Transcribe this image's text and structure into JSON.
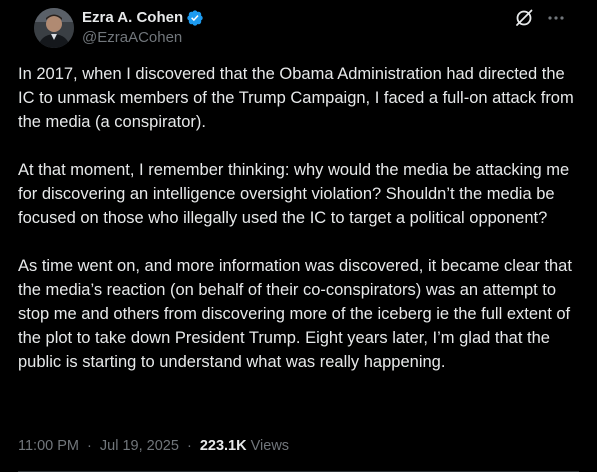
{
  "author": {
    "display_name": "Ezra A. Cohen",
    "handle": "@EzraACohen",
    "verified": true
  },
  "header_actions": {
    "grok_icon": "grok-slash-icon",
    "more_icon": "more-horizontal-icon"
  },
  "post": {
    "paragraphs": [
      "In 2017, when I discovered that the Obama Administration had directed the IC to unmask members of the Trump Campaign, I faced a full-on attack from the media (a conspirator).",
      "At that moment, I remember thinking: why would the media be attacking me for discovering an intelligence oversight violation? Shouldn’t the media be focused on those who illegally used the IC to target a political opponent?",
      "As time went on, and more information was discovered, it became clear that the media’s reaction (on behalf of their co-conspirators) was an attempt to stop me and others from discovering more of the iceberg ie the full extent of the plot to take down President Trump. Eight years later, I’m glad that the public is starting to understand what was really happening."
    ]
  },
  "meta": {
    "time": "11:00 PM",
    "date": "Jul 19, 2025",
    "views_count": "223.1K",
    "views_label": "Views",
    "separator": "·"
  },
  "colors": {
    "background": "#000000",
    "text_primary": "#e7e9ea",
    "text_secondary": "#71767b",
    "verified_badge": "#1d9bf0",
    "divider": "#2f3336"
  }
}
